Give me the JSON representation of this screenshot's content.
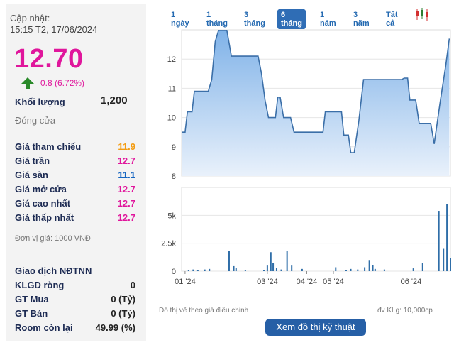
{
  "header": {
    "updated_label": "Cập nhật:",
    "updated_time": "15:15 T2, 17/06/2024"
  },
  "quote": {
    "price": "12.70",
    "change": "0.8 (6.72%)",
    "up_color": "#e0169c"
  },
  "volume": {
    "label": "Khối lượng",
    "value": "1,200"
  },
  "close_label": "Đóng cửa",
  "price_rows": [
    {
      "label": "Giá tham chiếu",
      "value": "11.9",
      "color": "#f39c12"
    },
    {
      "label": "Giá trần",
      "value": "12.7",
      "color": "#e0169c"
    },
    {
      "label": "Giá sàn",
      "value": "11.1",
      "color": "#1565c0"
    },
    {
      "label": "Giá mở cửa",
      "value": "12.7",
      "color": "#e0169c"
    },
    {
      "label": "Giá cao nhất",
      "value": "12.7",
      "color": "#e0169c"
    },
    {
      "label": "Giá thấp nhất",
      "value": "12.7",
      "color": "#e0169c"
    }
  ],
  "unit_note": "Đơn vị giá: 1000 VNĐ",
  "foreign_rows": [
    {
      "label": "Giao dịch NĐTNN",
      "value": ""
    },
    {
      "label": "KLGD ròng",
      "value": "0"
    },
    {
      "label": "GT Mua",
      "value": "0 (Tỷ)"
    },
    {
      "label": "GT Bán",
      "value": "0 (Tỷ)"
    },
    {
      "label": "Room còn lại",
      "value": "49.99 (%)"
    }
  ],
  "range_tabs": [
    {
      "label": "1 ngày",
      "active": false
    },
    {
      "label": "1 tháng",
      "active": false
    },
    {
      "label": "3 tháng",
      "active": false
    },
    {
      "label": "6 tháng",
      "active": true
    },
    {
      "label": "1 năm",
      "active": false
    },
    {
      "label": "3 năm",
      "active": false
    },
    {
      "label": "Tất cả",
      "active": false
    }
  ],
  "candle_icon": "candlestick-chart-icon",
  "chart_data": [
    {
      "type": "area",
      "ylim": [
        8,
        13
      ],
      "y_ticks": [
        "12",
        "11",
        "10",
        "9",
        "8"
      ],
      "y_tick_values": [
        12,
        11,
        10,
        9,
        8
      ],
      "x_ticks": [
        "01 '24",
        "03 '24",
        "04 '24",
        "05 '24",
        "06 '24"
      ],
      "points": [
        [
          0,
          9.5
        ],
        [
          0.015,
          9.5
        ],
        [
          0.025,
          10.2
        ],
        [
          0.045,
          10.2
        ],
        [
          0.055,
          10.9
        ],
        [
          0.115,
          10.9
        ],
        [
          0.13,
          11.3
        ],
        [
          0.145,
          12.6
        ],
        [
          0.16,
          13.0
        ],
        [
          0.195,
          13.0
        ],
        [
          0.215,
          12.1
        ],
        [
          0.33,
          12.1
        ],
        [
          0.345,
          11.5
        ],
        [
          0.36,
          10.6
        ],
        [
          0.375,
          10.0
        ],
        [
          0.405,
          10.0
        ],
        [
          0.415,
          10.7
        ],
        [
          0.425,
          10.7
        ],
        [
          0.44,
          10.0
        ],
        [
          0.47,
          10.0
        ],
        [
          0.485,
          9.5
        ],
        [
          0.61,
          9.5
        ],
        [
          0.62,
          10.2
        ],
        [
          0.69,
          10.2
        ],
        [
          0.7,
          9.4
        ],
        [
          0.72,
          9.4
        ],
        [
          0.73,
          8.8
        ],
        [
          0.745,
          8.8
        ],
        [
          0.765,
          9.9
        ],
        [
          0.785,
          11.3
        ],
        [
          0.95,
          11.3
        ],
        [
          0.96,
          11.35
        ],
        [
          0.975,
          11.35
        ],
        [
          0.985,
          10.6
        ],
        [
          1.01,
          10.6
        ],
        [
          1.025,
          9.8
        ],
        [
          1.075,
          9.8
        ],
        [
          1.09,
          9.1
        ],
        [
          1.115,
          10.5
        ],
        [
          1.14,
          11.8
        ],
        [
          1.155,
          12.7
        ]
      ]
    },
    {
      "type": "bar",
      "ylim": [
        0,
        7500
      ],
      "y_ticks": [
        "5k",
        "2.5k",
        "0"
      ],
      "y_tick_values": [
        5000,
        2500,
        0
      ],
      "bars": [
        [
          0.03,
          100
        ],
        [
          0.05,
          150
        ],
        [
          0.07,
          100
        ],
        [
          0.1,
          150
        ],
        [
          0.12,
          200
        ],
        [
          0.205,
          1800
        ],
        [
          0.225,
          450
        ],
        [
          0.235,
          300
        ],
        [
          0.275,
          100
        ],
        [
          0.355,
          100
        ],
        [
          0.37,
          500
        ],
        [
          0.385,
          1700
        ],
        [
          0.395,
          700
        ],
        [
          0.41,
          300
        ],
        [
          0.43,
          150
        ],
        [
          0.455,
          1800
        ],
        [
          0.475,
          500
        ],
        [
          0.52,
          200
        ],
        [
          0.665,
          350
        ],
        [
          0.71,
          100
        ],
        [
          0.73,
          200
        ],
        [
          0.76,
          150
        ],
        [
          0.79,
          350
        ],
        [
          0.81,
          1000
        ],
        [
          0.825,
          550
        ],
        [
          0.835,
          200
        ],
        [
          0.875,
          150
        ],
        [
          1.0,
          250
        ],
        [
          1.04,
          700
        ],
        [
          1.11,
          5400
        ],
        [
          1.13,
          2000
        ],
        [
          1.145,
          6000
        ],
        [
          1.16,
          1200
        ]
      ]
    }
  ],
  "footer": {
    "note_left": "Đồ thị vẽ theo giá điều chỉnh",
    "note_right": "đv KLg: 10,000cp",
    "button": "Xem đồ thị kỹ thuật"
  }
}
